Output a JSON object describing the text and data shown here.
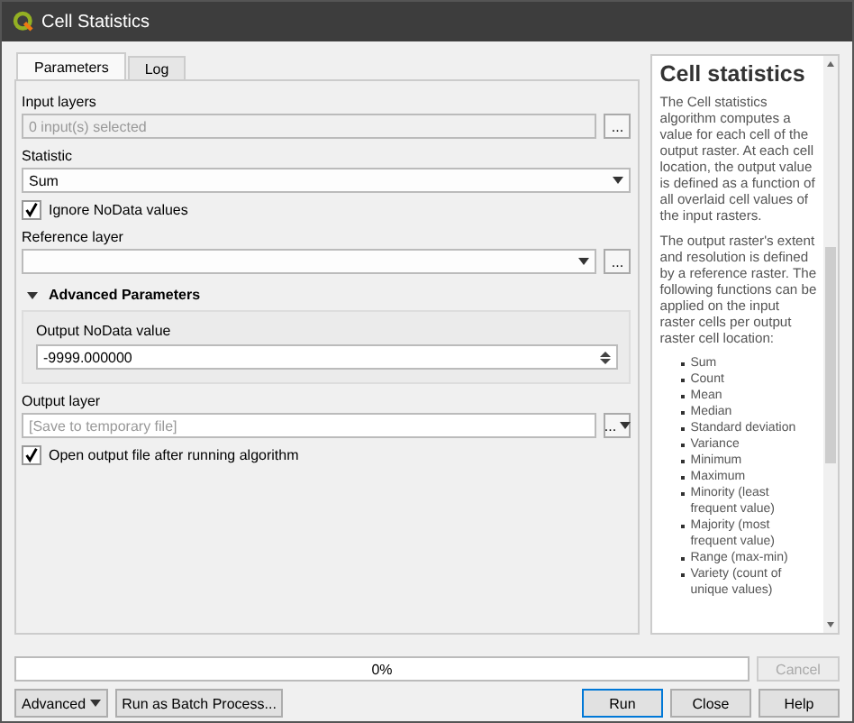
{
  "window": {
    "title": "Cell Statistics"
  },
  "tabs": [
    {
      "label": "Parameters",
      "selected": true
    },
    {
      "label": "Log",
      "selected": false
    }
  ],
  "parameters": {
    "input_layers": {
      "label": "Input layers",
      "value": "0 input(s) selected",
      "button": "..."
    },
    "statistic": {
      "label": "Statistic",
      "value": "Sum"
    },
    "ignore_nodata": {
      "label": "Ignore NoData values",
      "checked": true
    },
    "reference_layer": {
      "label": "Reference layer",
      "button": "..."
    },
    "advanced": {
      "label": "Advanced Parameters",
      "expanded": true,
      "nodata_label": "Output NoData value",
      "nodata_value": "-9999.000000"
    },
    "output_layer": {
      "label": "Output layer",
      "placeholder": "[Save to temporary file]",
      "button": "..."
    },
    "open_output": {
      "label": "Open output file after running algorithm",
      "checked": true
    }
  },
  "help": {
    "title": "Cell statistics",
    "paragraphs": [
      "The Cell statistics algorithm computes a value for each cell of the output raster. At each cell location, the output value is defined as a function of all overlaid cell values of the input rasters.",
      "The output raster's extent and resolution is defined by a reference raster. The following functions can be applied on the input raster cells per output raster cell location:"
    ],
    "functions": [
      "Sum",
      "Count",
      "Mean",
      "Median",
      "Standard deviation",
      "Variance",
      "Minimum",
      "Maximum",
      "Minority (least frequent value)",
      "Majority (most frequent value)",
      "Range (max-min)",
      "Variety (count of unique values)"
    ]
  },
  "progress": {
    "text": "0%",
    "level": 0
  },
  "cancel": {
    "label": "Cancel",
    "disabled": true
  },
  "footer": {
    "advanced": "Advanced",
    "batch": "Run as Batch Process...",
    "run": "Run",
    "close": "Close",
    "help": "Help"
  }
}
